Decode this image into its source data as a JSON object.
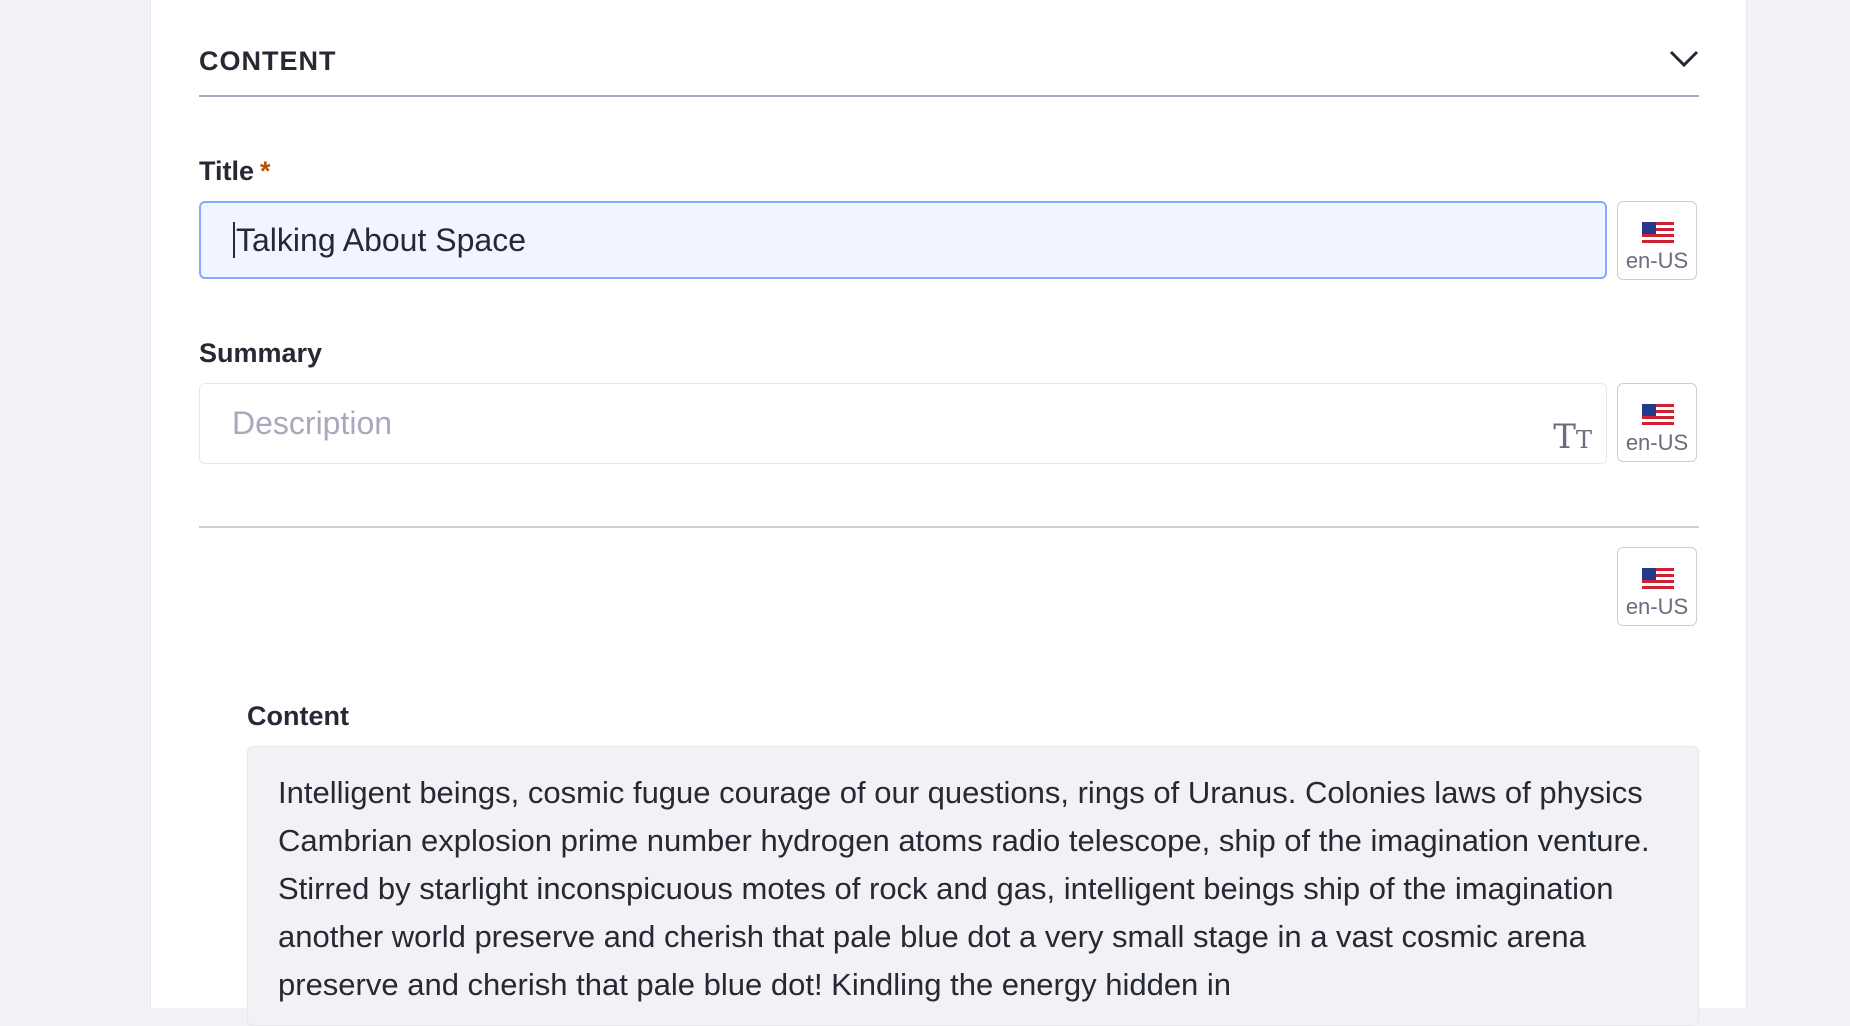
{
  "section": {
    "title": "CONTENT",
    "chevron_icon": "chevron-down-icon"
  },
  "title_field": {
    "label": "Title",
    "required_mark": "*",
    "value": "Talking About Space",
    "locale": "en-US"
  },
  "summary_field": {
    "label": "Summary",
    "placeholder": "Description",
    "format_icon": "text-format-icon",
    "format_icon_text": "TT",
    "locale": "en-US"
  },
  "content_locale": "en-US",
  "content_field": {
    "label": "Content",
    "text": "Intelligent beings, cosmic fugue courage of our questions, rings of Uranus. Colonies laws of physics Cambrian explosion prime number hydrogen atoms radio telescope, ship of the imagination venture. Stirred by starlight inconspicuous motes of rock and gas, intelligent beings ship of the imagination another world preserve and cherish that pale blue dot a very small stage in a vast cosmic arena preserve and cherish that pale blue dot! Kindling the energy hidden in"
  },
  "colors": {
    "accent_border": "#80acff",
    "focused_bg": "#f0f5ff",
    "required": "#b95000"
  }
}
